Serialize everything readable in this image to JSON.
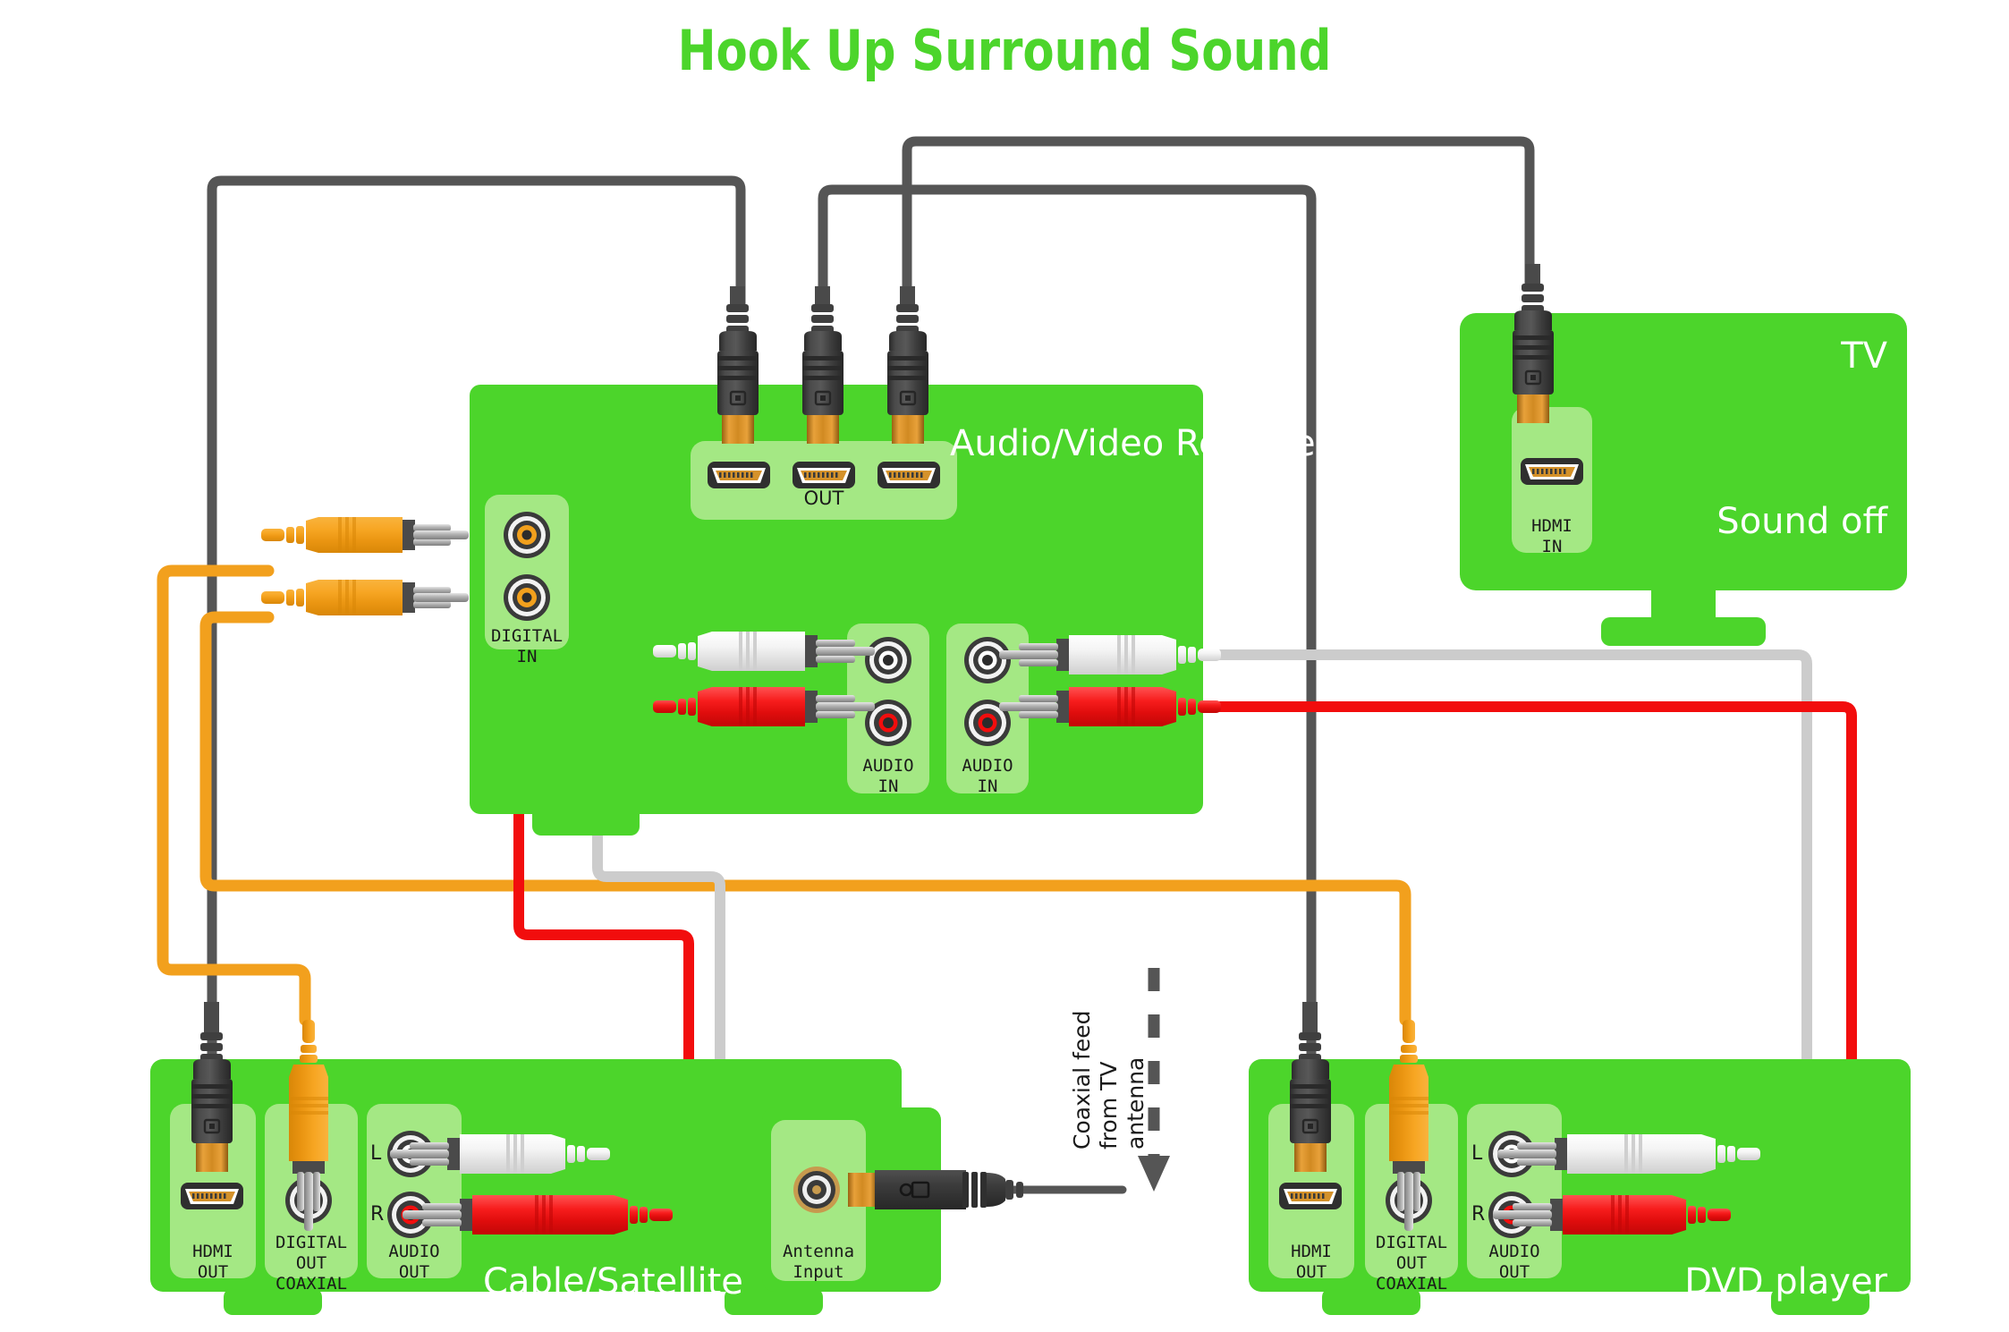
{
  "title": "Hook Up Surround Sound",
  "colors": {
    "title_green": "#4CD52B",
    "device_green": "#4CD52B",
    "port_panel_green": "#A4E884",
    "hdmi_cable": "#555555",
    "orange_cable": "#F2A01D",
    "red_cable": "#F20D0D",
    "white_cable": "#CCCCCC",
    "label_white": "#FFFFFF",
    "port_text": "#1A1A1A"
  },
  "devices": {
    "receiver": {
      "name": "Audio/Video Receiver",
      "name_line1": "Audio/Video",
      "name_line2": "Receiver",
      "ports": {
        "hdmi_out": "OUT",
        "digital_in": "DIGITAL\nIN",
        "audio_in_1": "AUDIO\nIN",
        "audio_in_2": "AUDIO\nIN"
      }
    },
    "tv": {
      "name": "TV",
      "status": "Sound off",
      "ports": {
        "hdmi_in": "HDMI\nIN"
      }
    },
    "cable_satellite": {
      "name": "Cable/Satellite",
      "ports": {
        "hdmi_out": "HDMI\nOUT",
        "digital_out": "DIGITAL\nOUT",
        "coaxial": "COAXIAL",
        "audio_out": "AUDIO\nOUT",
        "audio_left": "L",
        "audio_right": "R",
        "antenna_input": "Antenna\nInput"
      }
    },
    "dvd_player": {
      "name": "DVD player",
      "ports": {
        "hdmi_out": "HDMI\nOUT",
        "digital_out": "DIGITAL\nOUT",
        "coaxial": "COAXIAL",
        "audio_out": "AUDIO\nOUT",
        "audio_left": "L",
        "audio_right": "R"
      }
    }
  },
  "annotations": {
    "coax_feed": "Coaxial feed\nfrom TV\nantenna"
  }
}
